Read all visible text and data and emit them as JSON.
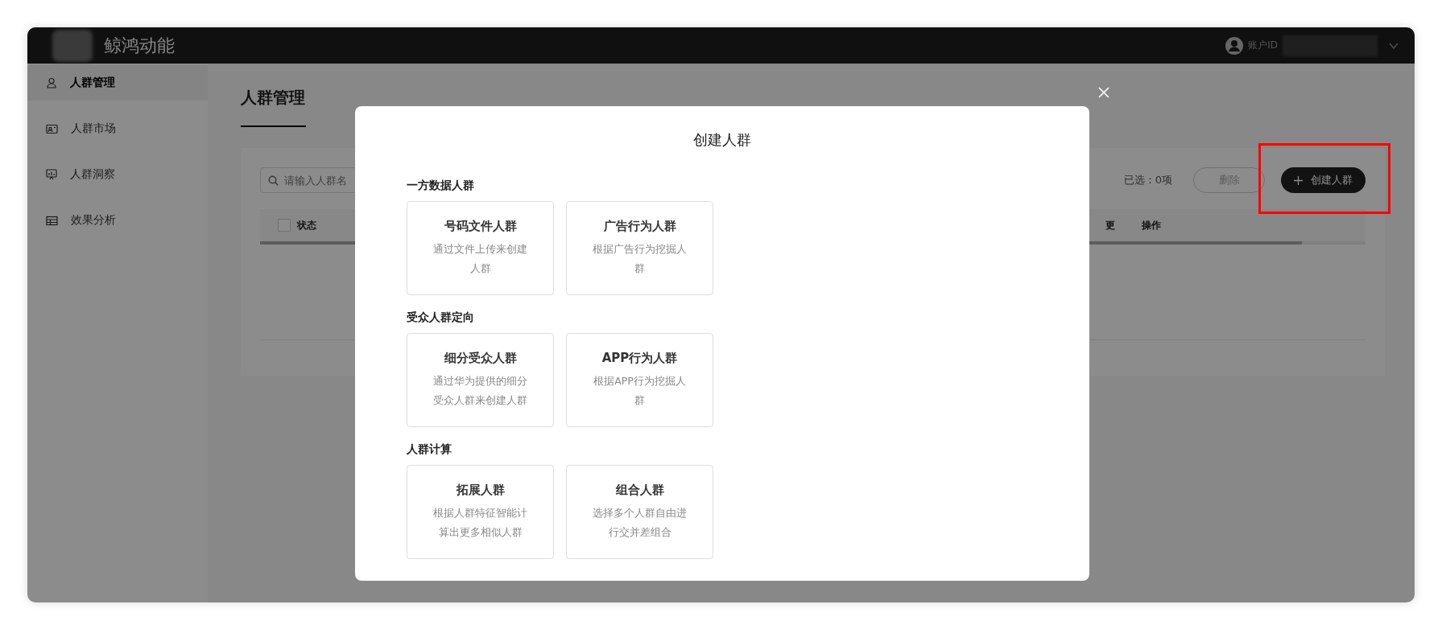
{
  "topbar": {
    "brand": "鲸鸿动能",
    "account_label": "账户ID"
  },
  "sidebar": {
    "items": [
      {
        "label": "人群管理",
        "selected": true
      },
      {
        "label": "人群市场",
        "selected": false
      },
      {
        "label": "人群洞察",
        "selected": false
      },
      {
        "label": "效果分析",
        "selected": false
      }
    ]
  },
  "page": {
    "title": "人群管理"
  },
  "toolbar": {
    "search_placeholder": "请输入人群名",
    "selected_count": "已选：0项",
    "delete_button": {
      "label": "删除",
      "disabled": true
    },
    "create_button": "创建人群"
  },
  "table": {
    "select_all_checked": false,
    "columns": [
      "状态",
      "更",
      "操作"
    ]
  },
  "modal": {
    "title": "创建人群",
    "sections": [
      {
        "heading": "一方数据人群",
        "cards": [
          {
            "title": "号码文件人群",
            "description": "通过文件上传来创建人群"
          },
          {
            "title": "广告行为人群",
            "description": "根据广告行为挖掘人群"
          }
        ]
      },
      {
        "heading": "受众人群定向",
        "cards": [
          {
            "title": "细分受众人群",
            "description": "通过华为提供的细分受众人群来创建人群"
          },
          {
            "title": "APP行为人群",
            "description": "根据APP行为挖掘人群"
          }
        ]
      },
      {
        "heading": "人群计算",
        "cards": [
          {
            "title": "拓展人群",
            "description": "根据人群特征智能计算出更多相似人群"
          },
          {
            "title": "组合人群",
            "description": "选择多个人群自由进行交并差组合"
          }
        ]
      }
    ]
  }
}
